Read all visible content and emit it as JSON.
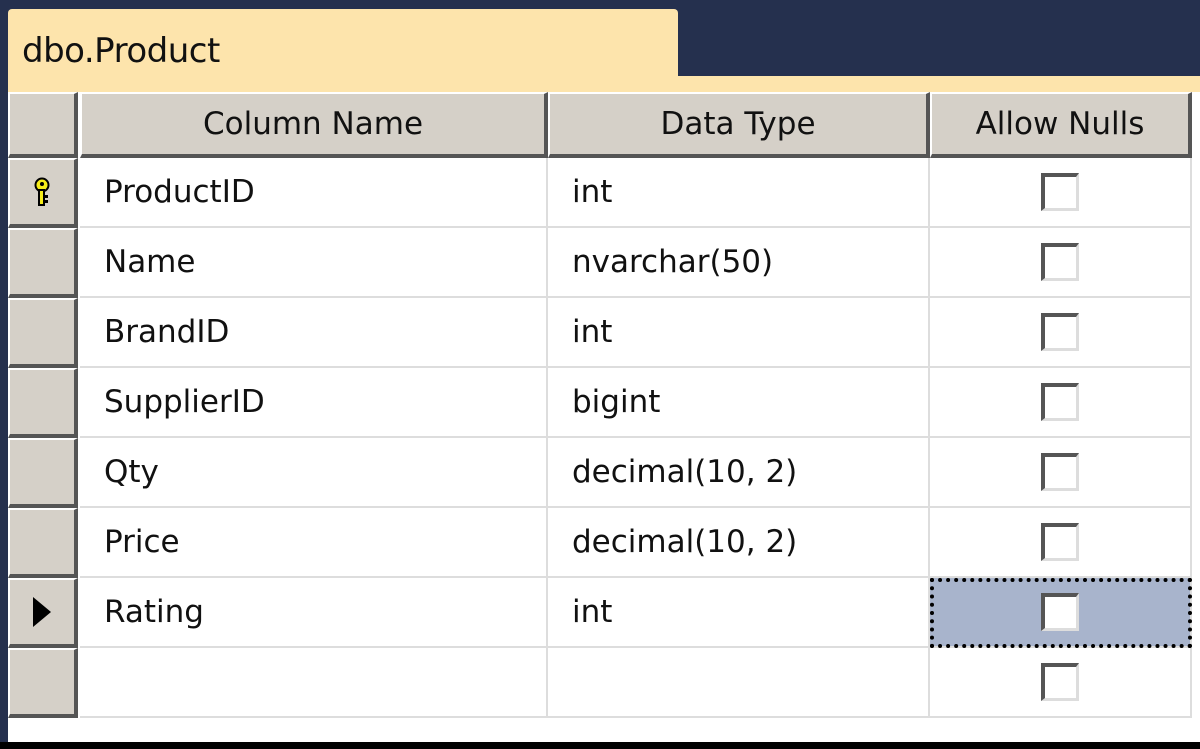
{
  "table_tab": {
    "title": "dbo.Product"
  },
  "grid": {
    "headers": [
      "Column Name",
      "Data Type",
      "Allow Nulls"
    ],
    "rows": [
      {
        "column_name": "ProductID",
        "data_type": "int",
        "allow_nulls": false,
        "indicator": "key-icon"
      },
      {
        "column_name": "Name",
        "data_type": "nvarchar(50)",
        "allow_nulls": false,
        "indicator": ""
      },
      {
        "column_name": "BrandID",
        "data_type": "int",
        "allow_nulls": false,
        "indicator": ""
      },
      {
        "column_name": "SupplierID",
        "data_type": "bigint",
        "allow_nulls": false,
        "indicator": ""
      },
      {
        "column_name": "Qty",
        "data_type": "decimal(10, 2)",
        "allow_nulls": false,
        "indicator": ""
      },
      {
        "column_name": "Price",
        "data_type": "decimal(10, 2)",
        "allow_nulls": false,
        "indicator": ""
      },
      {
        "column_name": "Rating",
        "data_type": "int",
        "allow_nulls": false,
        "indicator": "current-row-arrow-icon",
        "selected": true
      },
      {
        "column_name": "",
        "data_type": "",
        "allow_nulls": false,
        "indicator": ""
      }
    ]
  },
  "colors": {
    "background": "#25304e",
    "tab": "#fde4ac",
    "header": "#d5d0c8",
    "selection": "#a8b4cc",
    "key": "#f5ec1a"
  }
}
